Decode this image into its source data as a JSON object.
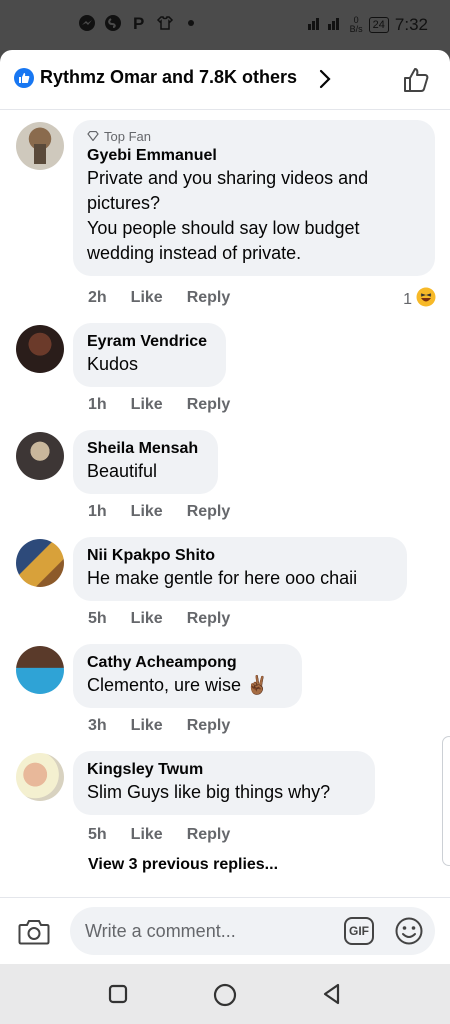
{
  "status_bar": {
    "icons": [
      "messenger-icon",
      "shazam-icon",
      "pinterest-icon",
      "shirt-icon",
      "dot-icon"
    ],
    "data_speed_value": "0",
    "data_speed_unit": "B/s",
    "battery": "24",
    "time": "7:32"
  },
  "header": {
    "reactions_text": "Rythmz Omar and 7.8K others",
    "accent_color": "#1877f2"
  },
  "comments": [
    {
      "badge": "Top Fan",
      "author": "Gyebi Emmanuel",
      "text": "Private and you sharing videos and pictures?\nYou people should say low budget wedding instead of private.",
      "time": "2h",
      "like": "Like",
      "reply": "Reply",
      "reaction_count": "1"
    },
    {
      "author": "Eyram Vendrice",
      "text": "Kudos",
      "time": "1h",
      "like": "Like",
      "reply": "Reply"
    },
    {
      "author": "Sheila Mensah",
      "text": "Beautiful",
      "time": "1h",
      "like": "Like",
      "reply": "Reply"
    },
    {
      "author": "Nii Kpakpo Shito",
      "text": "He make gentle for here ooo chaii",
      "time": "5h",
      "like": "Like",
      "reply": "Reply"
    },
    {
      "author": "Cathy Acheampong",
      "text": "Clemento, ure wise ✌🏾",
      "time": "3h",
      "like": "Like",
      "reply": "Reply"
    },
    {
      "author": "Kingsley Twum",
      "text": "Slim Guys like big things why?",
      "time": "5h",
      "like": "Like",
      "reply": "Reply"
    }
  ],
  "view_previous_replies": "View 3 previous replies...",
  "composer": {
    "placeholder": "Write a comment...",
    "gif_label": "GIF"
  }
}
